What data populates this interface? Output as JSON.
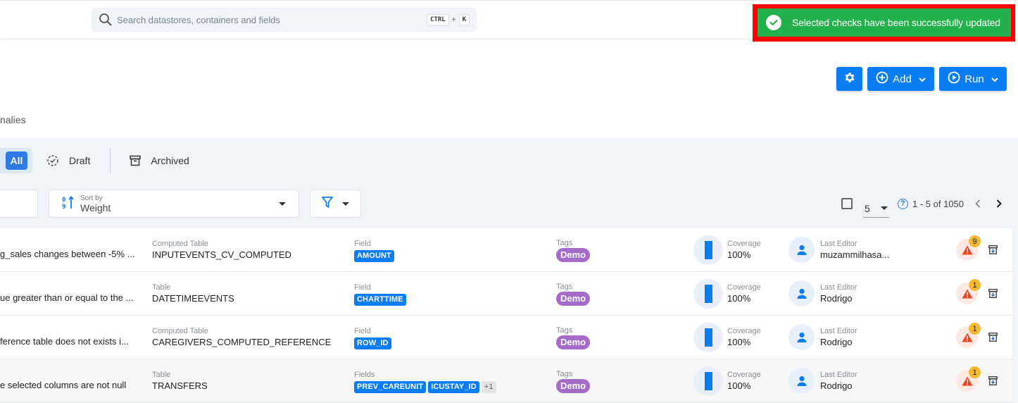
{
  "header": {
    "search_placeholder": "Search datastores, containers and fields",
    "shortcut_key1": "CTRL",
    "shortcut_plus": "+",
    "shortcut_key2": "K"
  },
  "toast": {
    "message": "Selected checks have been successfully updated",
    "type": "success",
    "color": "#23b14d",
    "highlight_color": "#ff0000"
  },
  "actions": {
    "settings_icon": "gear-icon",
    "add_label": "Add",
    "run_label": "Run"
  },
  "partial_tab_label": "nalies",
  "status_tabs": {
    "all_label": "All",
    "draft_label": "Draft",
    "archived_label": "Archived"
  },
  "toolbar": {
    "sort_by_label": "Sort by",
    "sort_by_value": "Weight"
  },
  "pagination": {
    "per_page": "5",
    "range": "1 - 5 of 1050"
  },
  "accent_color": "#0a7cf4",
  "rows": [
    {
      "description": "g_sales changes between -5% ...",
      "container_label": "Computed Table",
      "container": "INPUTEVENTS_CV_COMPUTED",
      "fields_label": "Field",
      "fields": [
        "AMOUNT"
      ],
      "fields_more": "",
      "tags_label": "Tags",
      "tag": "Demo",
      "coverage_label": "Coverage",
      "coverage": "100%",
      "editor_label": "Last Editor",
      "editor": "muzammilhasa...",
      "anomalies": "9"
    },
    {
      "description": "ue greater than or equal to the ...",
      "container_label": "Table",
      "container": "DATETIMEEVENTS",
      "fields_label": "Field",
      "fields": [
        "CHARTTIME"
      ],
      "fields_more": "",
      "tags_label": "Tags",
      "tag": "Demo",
      "coverage_label": "Coverage",
      "coverage": "100%",
      "editor_label": "Last Editor",
      "editor": "Rodrigo",
      "anomalies": "1"
    },
    {
      "description": "ference table does not exists i...",
      "container_label": "Computed Table",
      "container": "CAREGIVERS_COMPUTED_REFERENCE",
      "fields_label": "Field",
      "fields": [
        "ROW_ID"
      ],
      "fields_more": "",
      "tags_label": "Tags",
      "tag": "Demo",
      "coverage_label": "Coverage",
      "coverage": "100%",
      "editor_label": "Last Editor",
      "editor": "Rodrigo",
      "anomalies": "1"
    },
    {
      "description": "e selected columns are not null",
      "container_label": "Table",
      "container": "TRANSFERS",
      "fields_label": "Fields",
      "fields": [
        "PREV_CAREUNIT",
        "ICUSTAY_ID"
      ],
      "fields_more": "+1",
      "tags_label": "Tags",
      "tag": "Demo",
      "coverage_label": "Coverage",
      "coverage": "100%",
      "editor_label": "Last Editor",
      "editor": "Rodrigo",
      "anomalies": "1"
    }
  ]
}
